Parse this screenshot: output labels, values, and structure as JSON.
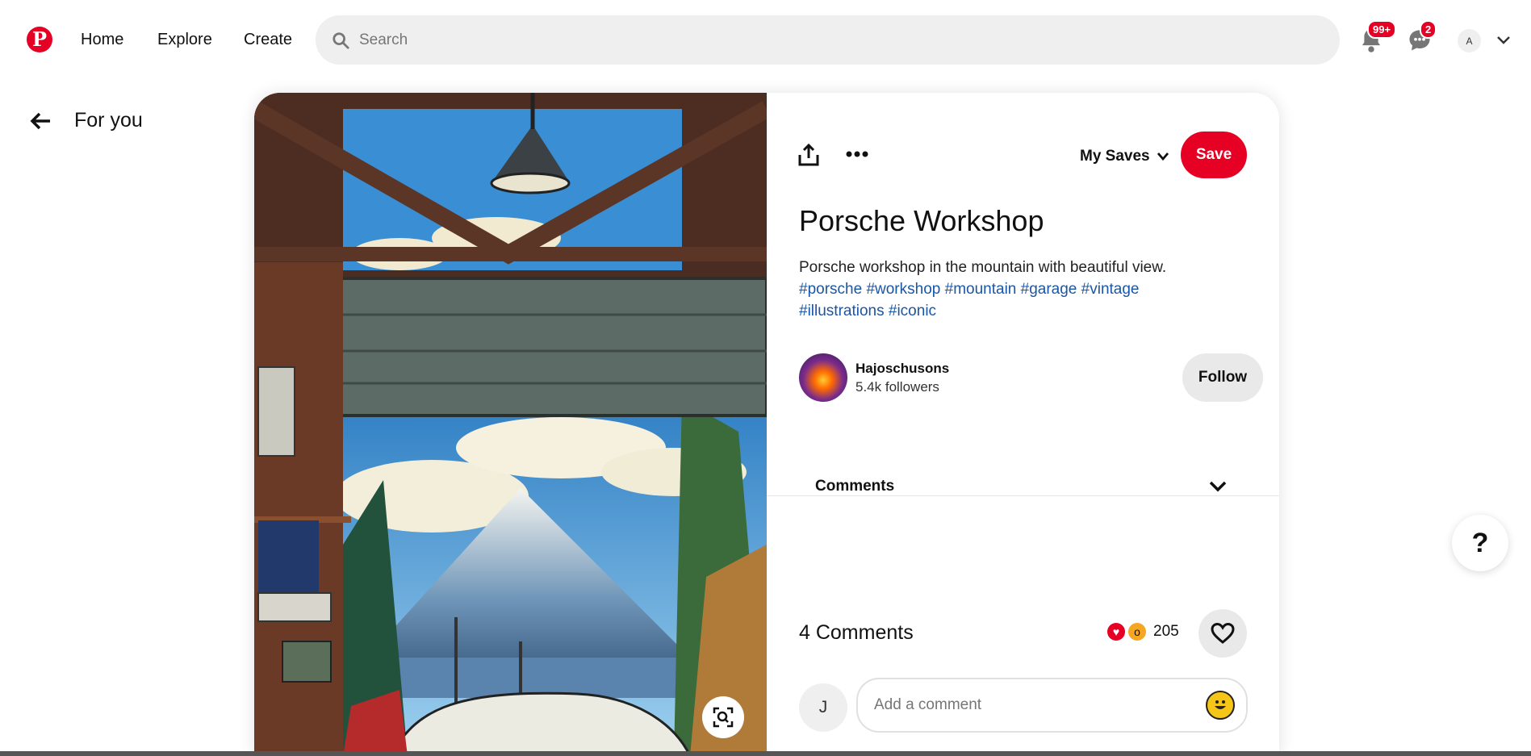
{
  "nav": {
    "home": "Home",
    "explore": "Explore",
    "create": "Create",
    "search_placeholder": "Search",
    "notifications_badge": "99+",
    "messages_badge": "2",
    "avatar_initial": "A"
  },
  "back": {
    "label": "For you"
  },
  "pin": {
    "board": "My Saves",
    "save_label": "Save",
    "title": "Porsche Workshop",
    "description": "Porsche workshop in the mountain with beautiful view.",
    "tags": [
      "#porsche",
      "#workshop",
      "#mountain",
      "#garage",
      "#vintage",
      "#illustrations",
      "#iconic"
    ]
  },
  "creator": {
    "name": "Hajoschusons",
    "followers": "5.4k followers",
    "follow_label": "Follow"
  },
  "comments": {
    "section_label": "Comments",
    "count_label": "4 Comments",
    "reactions": "205",
    "user_initial": "J",
    "placeholder": "Add a comment"
  },
  "help": {
    "label": "?"
  },
  "colors": {
    "brand": "#e60023",
    "link": "#1a56a6"
  }
}
